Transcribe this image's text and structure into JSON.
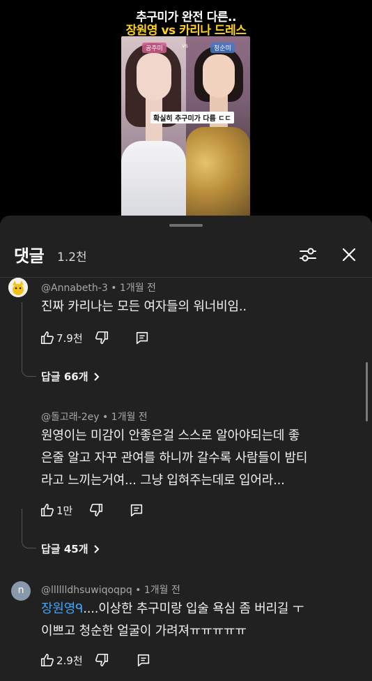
{
  "video": {
    "title_line1": "추구미가 완전 다른..",
    "title_line2": "장원영 vs 카리나 드레스",
    "tag_left": "공주미",
    "tag_vs": "vs",
    "tag_right": "청순미",
    "caption": "확실히 추구미가 다름 ㄷㄷ"
  },
  "sheet": {
    "title": "댓글",
    "count": "1.2천"
  },
  "comments": [
    {
      "author": "@Annabeth-3",
      "time": "1개월 전",
      "body_lines": [
        "진짜 카리나는 모든 여자들의 워너비임.."
      ],
      "likes": "7.9천",
      "replies": "답글 66개"
    },
    {
      "author": "@돌고래-2ey",
      "time": "1개월 전",
      "body_lines": [
        "원영이는 미감이 안좋은걸 스스로 알아야되는데 좋",
        "은줄 알고 자꾸 관여를 하니까 갈수록 사람들이 밤티",
        "라고 느끼는거여... 그냥 입혀주는데로 입어라..."
      ],
      "likes": "1만",
      "replies": "답글 45개"
    },
    {
      "author": "@lllllldhsuwiqoqpq",
      "avatar_letter": "n",
      "time": "1개월 전",
      "mention": "장원영ᑫ",
      "body_line1_rest": "....이상한 추구미랑 입술 욕심 좀 버리길 ㅜ",
      "body_line2": "이쁘고 청순한 얼굴이 가려져ㅠㅠㅠㅠㅠ",
      "likes": "2.9천"
    }
  ],
  "meta_separator": "•",
  "icons": [
    "thumb-up-icon",
    "thumb-down-icon",
    "reply-icon",
    "filter-icon",
    "close-icon",
    "chevron-right-icon"
  ],
  "colors": {
    "background": "#000000",
    "sheet": "#212121",
    "mention": "#3ea6ff",
    "title_yellow": "#ffd21f"
  }
}
